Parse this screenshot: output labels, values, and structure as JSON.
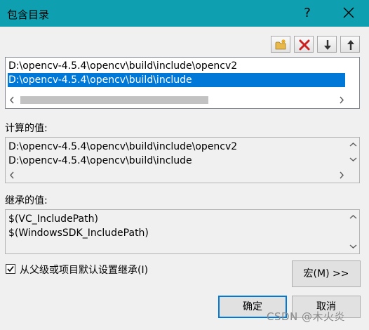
{
  "window": {
    "title": "包含目录",
    "help_glyph": "?"
  },
  "directory_list": {
    "items": [
      "D:\\opencv-4.5.4\\opencv\\build\\include\\opencv2",
      "D:\\opencv-4.5.4\\opencv\\build\\include"
    ],
    "selected_index": 1
  },
  "computed": {
    "label": "计算的值:",
    "items": [
      "D:\\opencv-4.5.4\\opencv\\build\\include\\opencv2",
      "D:\\opencv-4.5.4\\opencv\\build\\include"
    ]
  },
  "inherited": {
    "label": "继承的值:",
    "items": [
      "$(VC_IncludePath)",
      "$(WindowsSDK_IncludePath)"
    ]
  },
  "inherit_checkbox": {
    "label": "从父级或项目默认设置继承(I)",
    "checked": true
  },
  "buttons": {
    "macro": "宏(M) >>",
    "ok": "确定",
    "cancel": "取消"
  },
  "watermark": "CSDN @木火炎",
  "colors": {
    "titlebar": "#0e9fb0",
    "selection": "#0078d7",
    "default_button_border": "#0078d7"
  },
  "icons": {
    "new_line": "folder-new-icon",
    "delete": "delete-x-icon",
    "move_down": "arrow-down-icon",
    "move_up": "arrow-up-icon"
  }
}
